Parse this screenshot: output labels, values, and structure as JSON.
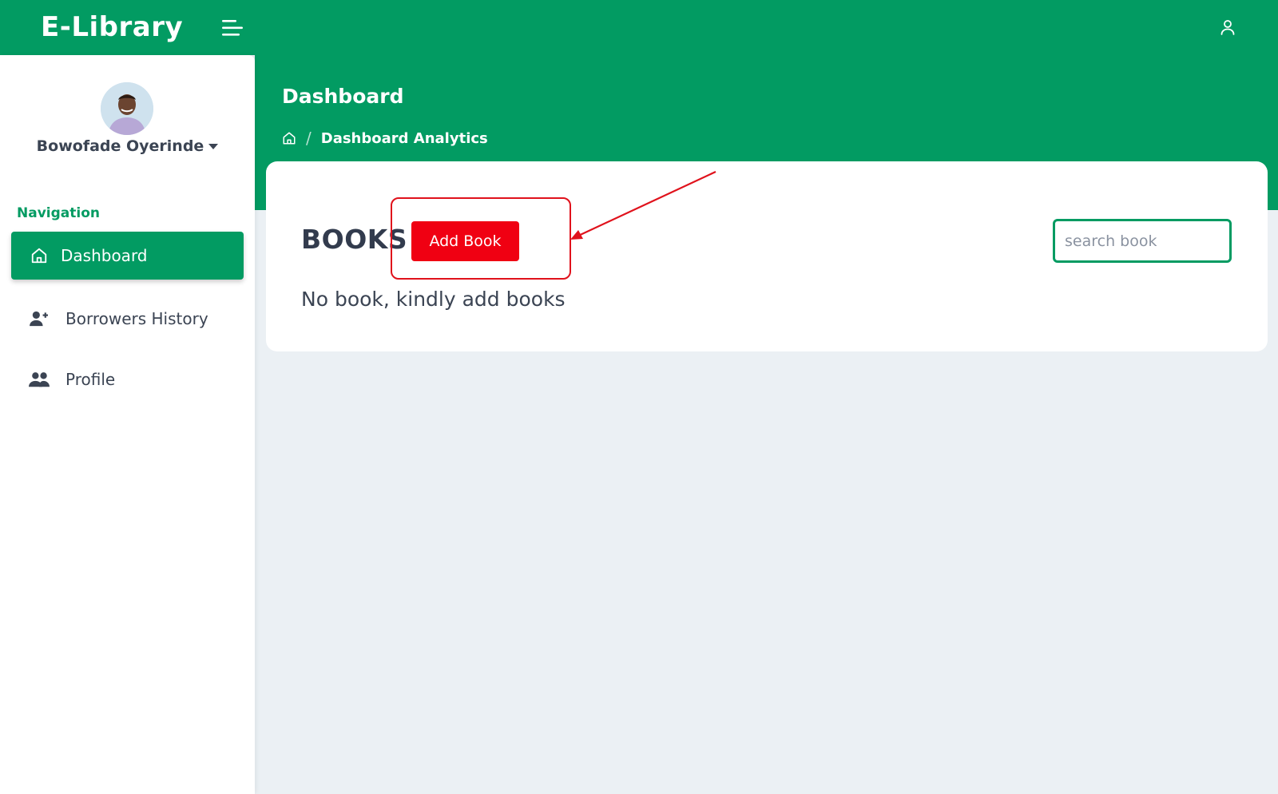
{
  "app": {
    "title": "E-Library"
  },
  "header": {
    "page_title": "Dashboard",
    "breadcrumb": [
      "Dashboard Analytics"
    ]
  },
  "sidebar": {
    "user_name": "Bowofade Oyerinde",
    "nav_heading": "Navigation",
    "items": [
      {
        "label": "Dashboard",
        "icon": "home-icon",
        "active": true
      },
      {
        "label": "Borrowers History",
        "icon": "user-plus-icon",
        "active": false
      },
      {
        "label": "Profile",
        "icon": "users-icon",
        "active": false
      }
    ]
  },
  "main": {
    "section_title": "BOOKS",
    "add_button_label": "Add Book",
    "search_placeholder": "search book",
    "empty_message": "No book, kindly add books"
  },
  "colors": {
    "brand_green": "#029b62",
    "add_button_red": "#f00012",
    "annotation_red": "#e0121c",
    "page_background": "#ebf0f4"
  }
}
